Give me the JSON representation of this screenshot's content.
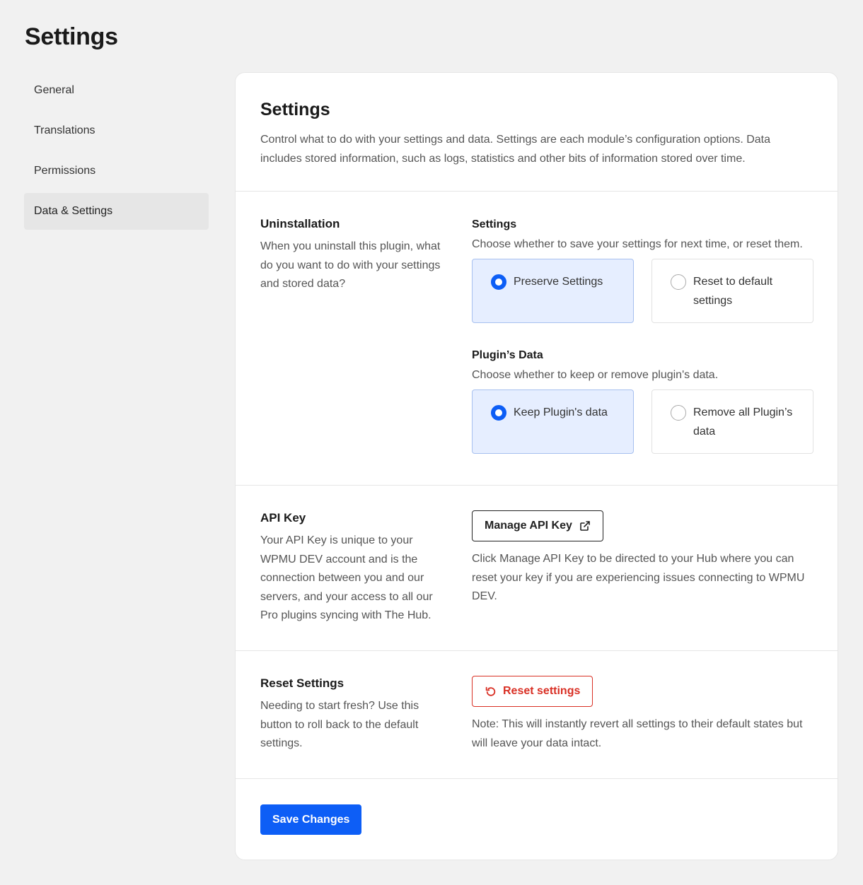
{
  "page": {
    "title": "Settings"
  },
  "sidebar": {
    "items": [
      {
        "label": "General"
      },
      {
        "label": "Translations"
      },
      {
        "label": "Permissions"
      },
      {
        "label": "Data & Settings"
      }
    ]
  },
  "card": {
    "title": "Settings",
    "description": "Control what to do with your settings and data. Settings are each module’s configuration options. Data includes stored information, such as logs, statistics and other bits of information stored over time."
  },
  "uninstallation": {
    "title": "Uninstallation",
    "text": "When you uninstall this plugin, what do you want to do with your settings and stored data?",
    "settings": {
      "title": "Settings",
      "text": "Choose whether to save your settings for next time, or reset them.",
      "options": [
        {
          "label": "Preserve Settings",
          "selected": true
        },
        {
          "label": "Reset to default settings",
          "selected": false
        }
      ]
    },
    "plugin_data": {
      "title": "Plugin’s Data",
      "text": "Choose whether to keep or remove plugin's data.",
      "options": [
        {
          "label": "Keep Plugin's data",
          "selected": true
        },
        {
          "label": "Remove all Plugin’s data",
          "selected": false
        }
      ]
    }
  },
  "api_key": {
    "title": "API Key",
    "text": "Your API Key is unique to your WPMU DEV account and is the connection between you and our servers, and your access to all our Pro plugins syncing with The Hub.",
    "button_label": "Manage API Key",
    "help": "Click Manage API Key to be directed to your Hub where you can reset your key if you are experiencing issues connecting to WPMU DEV."
  },
  "reset": {
    "title": "Reset Settings",
    "text": "Needing to start fresh? Use this button to roll back to the default settings.",
    "button_label": "Reset settings",
    "note": "Note: This will instantly revert all settings to their default states but will leave your data intact."
  },
  "footer": {
    "save_label": "Save Changes"
  },
  "colors": {
    "primary": "#0d5ef6",
    "danger": "#d93025",
    "selected_bg": "#e6eeff"
  }
}
